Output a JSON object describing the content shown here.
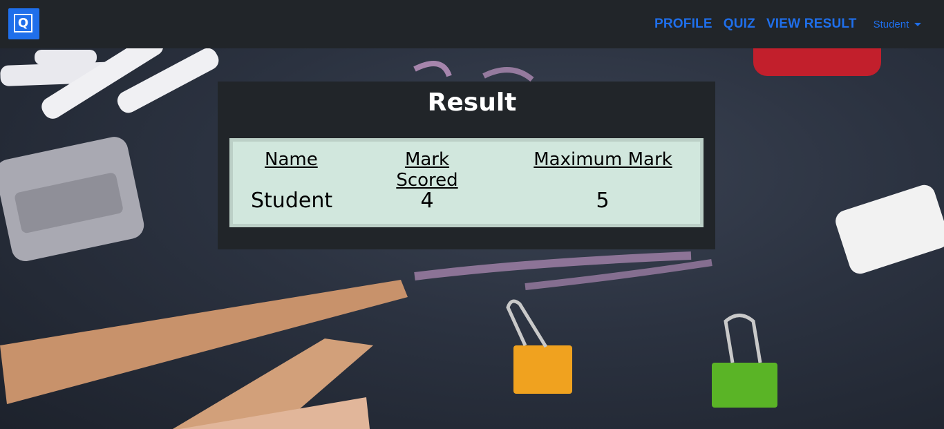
{
  "nav": {
    "logo_letter": "Q",
    "links": [
      "PROFILE",
      "QUIZ",
      "VIEW RESULT"
    ],
    "user_dropdown": "Student"
  },
  "result": {
    "title": "Result",
    "columns": [
      "Name",
      "Mark Scored",
      "Maximum Mark"
    ],
    "row": [
      "Student",
      "4",
      "5"
    ]
  },
  "colors": {
    "navbar": "#212529",
    "accent": "#1f6feb",
    "table_bg": "#d1e7dd"
  }
}
